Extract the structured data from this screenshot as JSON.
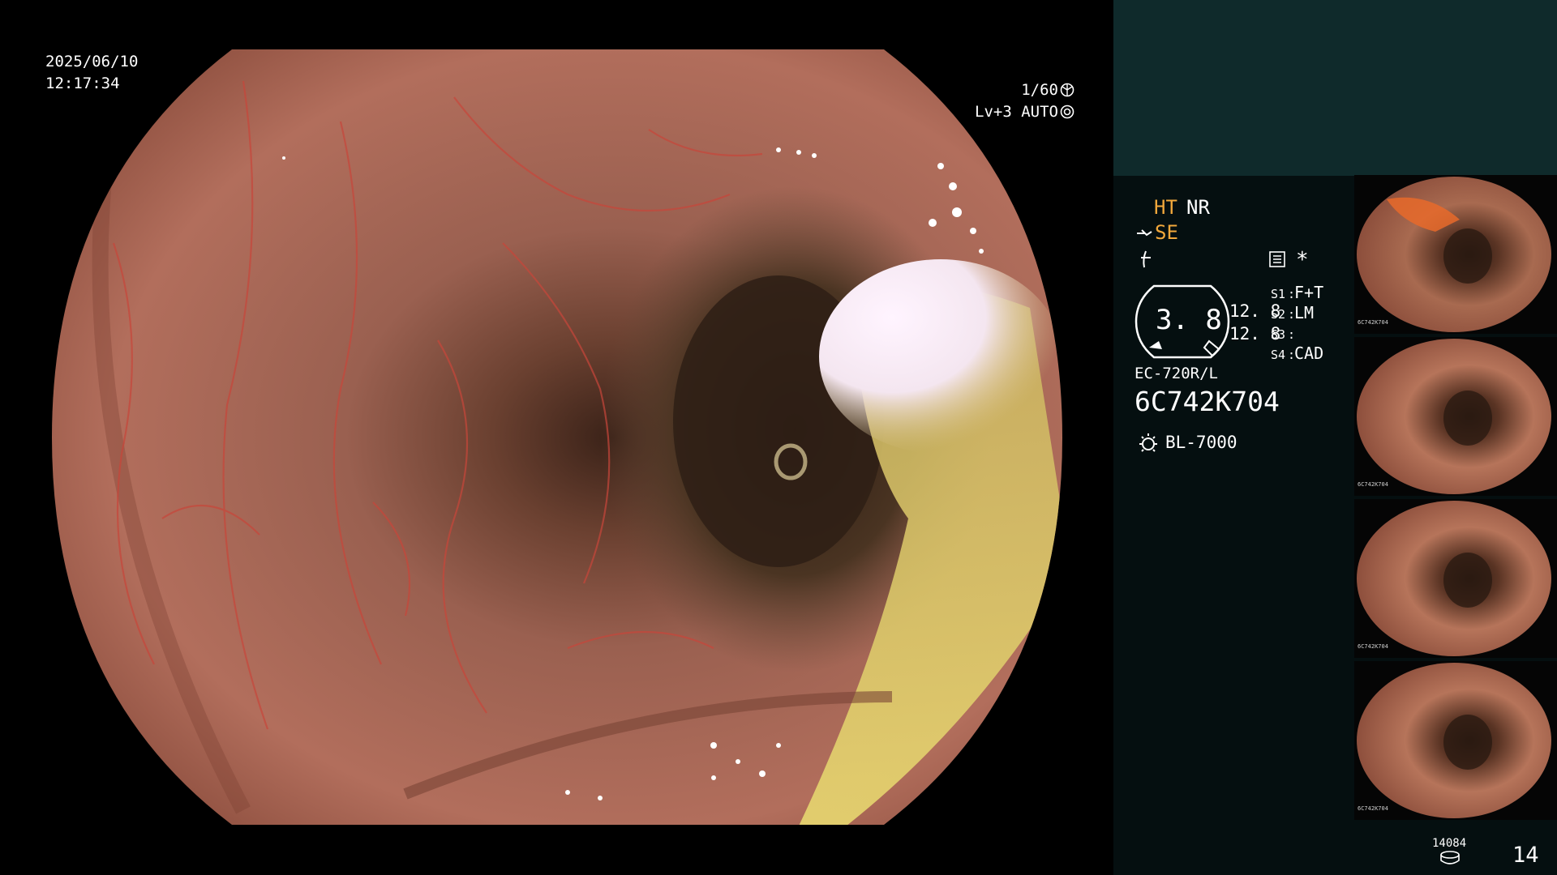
{
  "screen": {
    "date": "2025/06/10",
    "time": "12:17:34",
    "shutter": "1/60",
    "level": "Lv+3",
    "exposure_mode": "AUTO"
  },
  "panel": {
    "ht": "HT",
    "nr": "NR",
    "se": "SE",
    "zoom_value": "3. 8",
    "value_upper": "12. 8",
    "value_lower": "12. 8",
    "s1_key": "S1",
    "s1_value": "F+T",
    "s2_key": "S2",
    "s2_value": "LM",
    "s3_key": "S3",
    "s3_value": "",
    "s4_key": "S4",
    "s4_value": "CAD",
    "scope_model": "EC-720R/L",
    "serial": "6C742K704",
    "light_source": "BL-7000",
    "image_count": "14084",
    "capture_index": "14",
    "icons": [
      "scope-angle-icon",
      "freeze-icon",
      "settings-list-icon",
      "asterisk-icon",
      "lamp-icon",
      "storage-disk-icon"
    ]
  },
  "thumbnails": [
    {
      "serial": "6C742K704"
    },
    {
      "serial": "6C742K704"
    },
    {
      "serial": "6C742K704"
    },
    {
      "serial": "6C742K704"
    }
  ],
  "colors": {
    "panel_bg": "#050f10",
    "panel_top_bg": "#0f2a2b",
    "accent_orange": "#f2a83b",
    "mucosa": "#b86a55"
  }
}
